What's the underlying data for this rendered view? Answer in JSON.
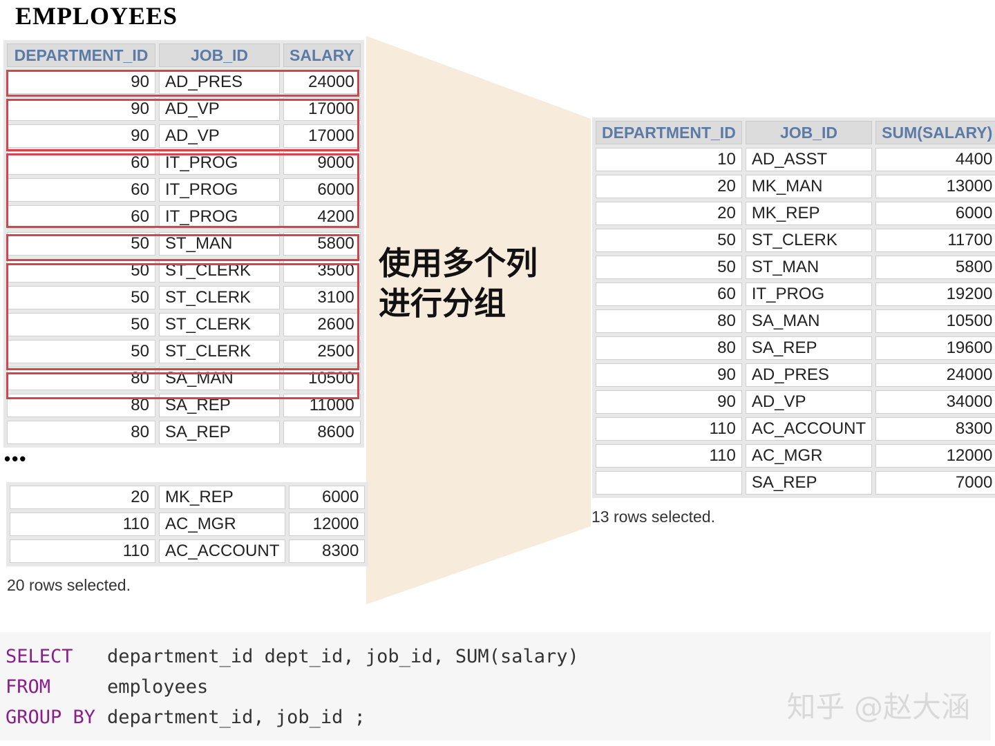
{
  "title": "EMPLOYEES",
  "caption": [
    "使用多个列",
    "进行分组"
  ],
  "left_table": {
    "headers": [
      "DEPARTMENT_ID",
      "JOB_ID",
      "SALARY"
    ],
    "rows": [
      [
        "90",
        "AD_PRES",
        "24000"
      ],
      [
        "90",
        "AD_VP",
        "17000"
      ],
      [
        "90",
        "AD_VP",
        "17000"
      ],
      [
        "60",
        "IT_PROG",
        "9000"
      ],
      [
        "60",
        "IT_PROG",
        "6000"
      ],
      [
        "60",
        "IT_PROG",
        "4200"
      ],
      [
        "50",
        "ST_MAN",
        "5800"
      ],
      [
        "50",
        "ST_CLERK",
        "3500"
      ],
      [
        "50",
        "ST_CLERK",
        "3100"
      ],
      [
        "50",
        "ST_CLERK",
        "2600"
      ],
      [
        "50",
        "ST_CLERK",
        "2500"
      ],
      [
        "80",
        "SA_MAN",
        "10500"
      ],
      [
        "80",
        "SA_REP",
        "11000"
      ],
      [
        "80",
        "SA_REP",
        "8600"
      ]
    ],
    "ellipsis": "•••",
    "tail_rows": [
      [
        "20",
        "MK_REP",
        "6000"
      ],
      [
        "110",
        "AC_MGR",
        "12000"
      ],
      [
        "110",
        "AC_ACCOUNT",
        "8300"
      ]
    ],
    "rows_selected": "20 rows selected."
  },
  "right_table": {
    "headers": [
      "DEPARTMENT_ID",
      "JOB_ID",
      "SUM(SALARY)"
    ],
    "rows": [
      [
        "10",
        "AD_ASST",
        "4400"
      ],
      [
        "20",
        "MK_MAN",
        "13000"
      ],
      [
        "20",
        "MK_REP",
        "6000"
      ],
      [
        "50",
        "ST_CLERK",
        "11700"
      ],
      [
        "50",
        "ST_MAN",
        "5800"
      ],
      [
        "60",
        "IT_PROG",
        "19200"
      ],
      [
        "80",
        "SA_MAN",
        "10500"
      ],
      [
        "80",
        "SA_REP",
        "19600"
      ],
      [
        "90",
        "AD_PRES",
        "24000"
      ],
      [
        "90",
        "AD_VP",
        "34000"
      ],
      [
        "110",
        "AC_ACCOUNT",
        "8300"
      ],
      [
        "110",
        "AC_MGR",
        "12000"
      ],
      [
        "",
        "SA_REP",
        "7000"
      ]
    ],
    "rows_selected": "13 rows selected."
  },
  "code": {
    "lines": [
      {
        "keyword": "SELECT",
        "rest": "department_id dept_id, job_id, SUM(salary)"
      },
      {
        "keyword": "FROM",
        "rest": "employees"
      },
      {
        "keyword": "GROUP BY",
        "rest": "department_id, job_id ;"
      }
    ]
  },
  "watermark": "知乎 @赵大涵",
  "colors": {
    "header_text": "#5c7aa6",
    "highlight_box": "#d7434c",
    "funnel": "#f7ebdc",
    "sql_keyword": "#8a1e8c"
  }
}
